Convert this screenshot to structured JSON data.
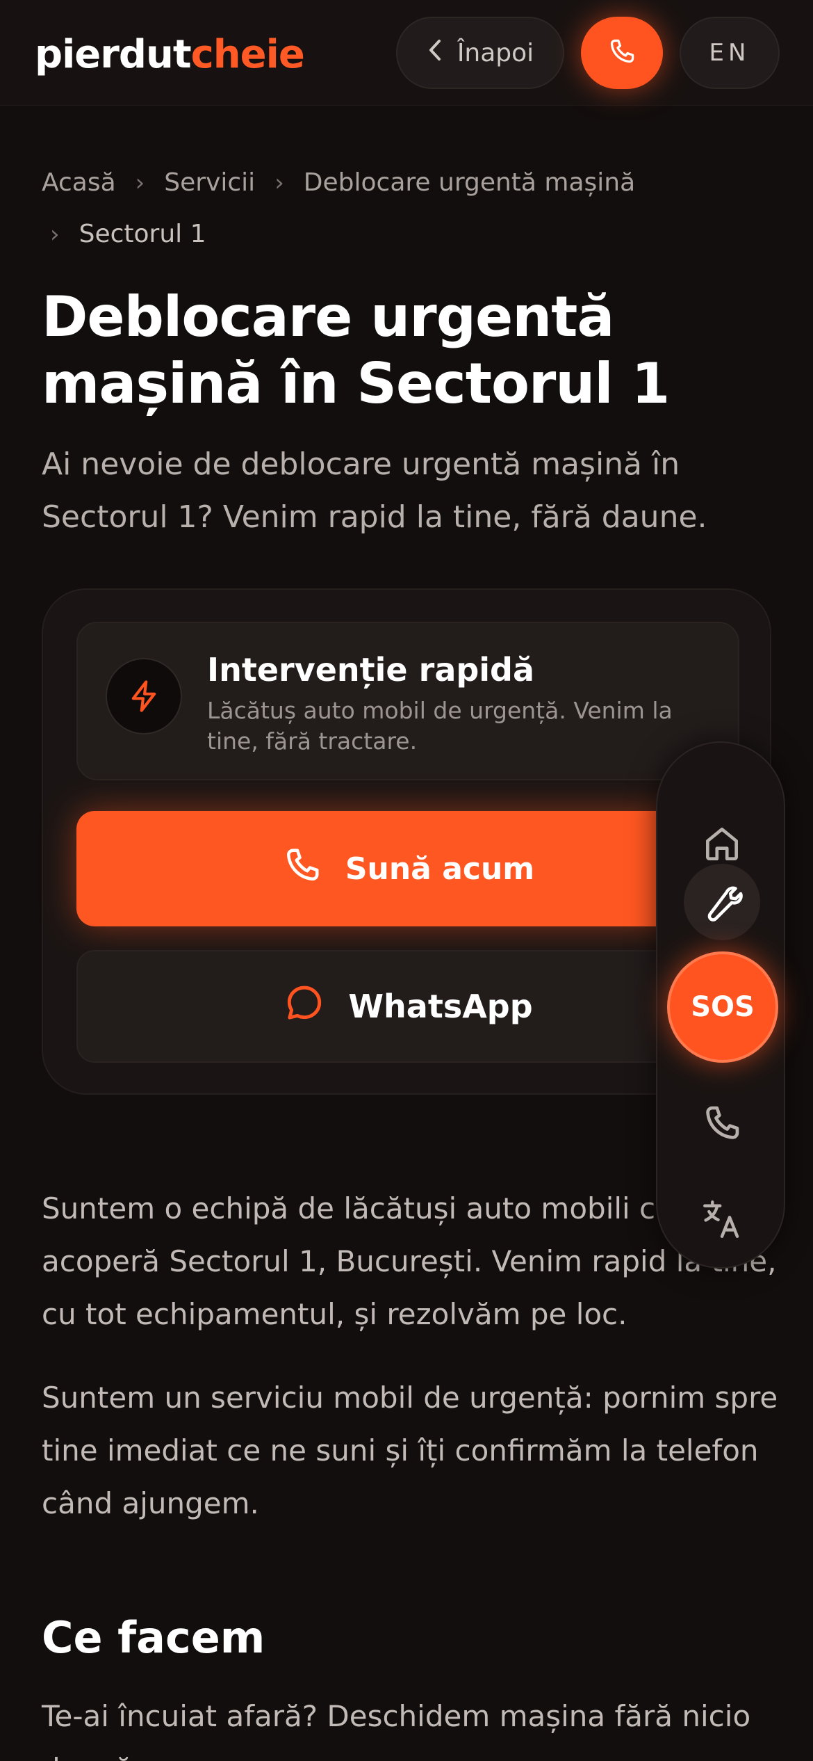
{
  "header": {
    "logo_part1": "pierdut",
    "logo_part2": "cheie",
    "back_label": "Înapoi",
    "lang_label": "EN",
    "brand_color": "#ff5320"
  },
  "breadcrumb": {
    "items": [
      "Acasă",
      "Servicii",
      "Deblocare urgentă mașină",
      "Sectorul 1"
    ]
  },
  "hero": {
    "title": "Deblocare urgentă mașină în Sectorul 1",
    "subtitle": "Ai nevoie de deblocare urgentă mașină în Sectorul 1? Venim rapid la tine, fără daune."
  },
  "card": {
    "feature_title": "Intervenție rapidă",
    "feature_desc": "Lăcătuș auto mobil de urgență. Venim la tine, fără tractare.",
    "feature_icon": "lightning-icon",
    "call_label": "Sună acum",
    "whatsapp_label": "WhatsApp"
  },
  "content": {
    "para1": "Suntem o echipă de lăcătuși auto mobili care acoperă Sectorul 1, București. Venim rapid la tine, cu tot echipamentul, și rezolvăm pe loc.",
    "para2": "Suntem un serviciu mobil de urgență: pornim spre tine imediat ce ne suni și îți confirmăm la telefon când ajungem.",
    "heading": "Ce facem",
    "para3": "Te-ai încuiat afară? Deschidem mașina fără nicio daună."
  },
  "dock": {
    "items": [
      "home-icon",
      "wrench-icon",
      "SOS",
      "phone-icon",
      "translate-icon"
    ],
    "sos_label": "SOS"
  }
}
